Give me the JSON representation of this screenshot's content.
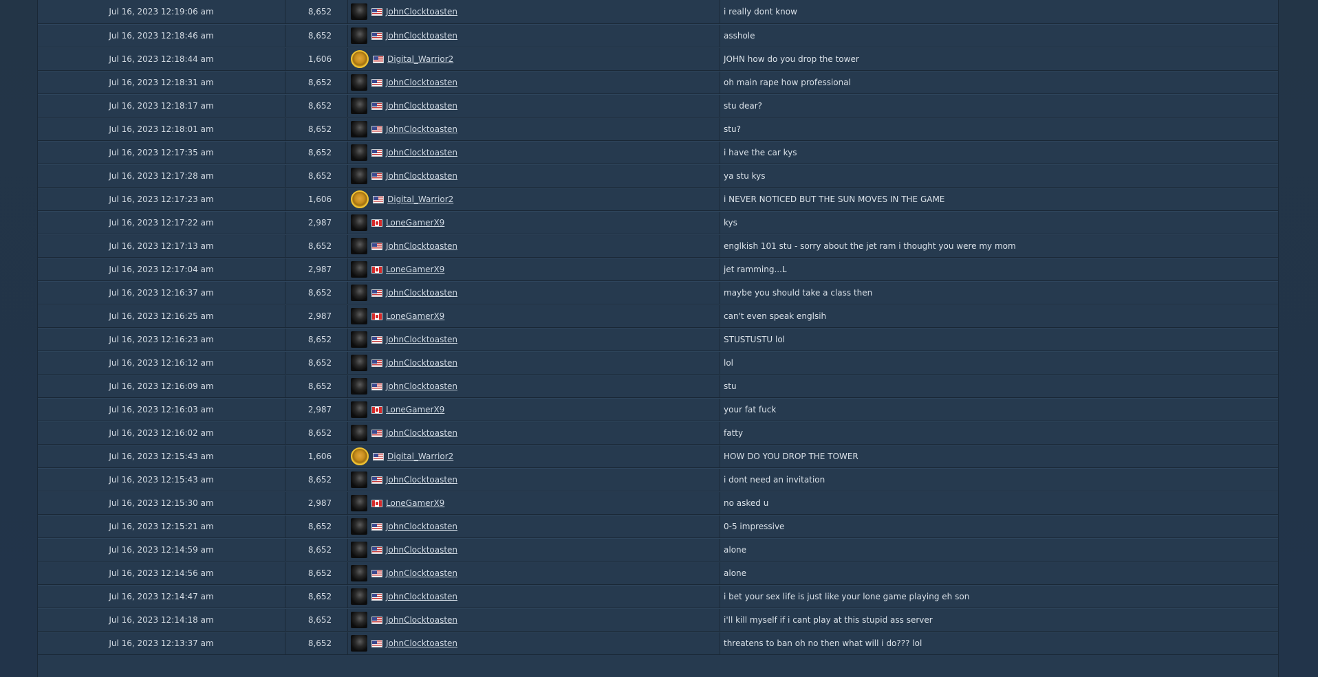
{
  "colors": {
    "background": "#233446",
    "row": "#263a4f",
    "border": "#1a2836",
    "text": "#d3dae2"
  },
  "chat_log": {
    "rows": [
      {
        "time": "Jul 16, 2023 12:19:06 am",
        "score": "8,652",
        "avatar": "dark",
        "flag": "us",
        "player": "JohnClocktoasten",
        "message": "i really dont know"
      },
      {
        "time": "Jul 16, 2023 12:18:46 am",
        "score": "8,652",
        "avatar": "dark",
        "flag": "us",
        "player": "JohnClocktoasten",
        "message": "asshole"
      },
      {
        "time": "Jul 16, 2023 12:18:44 am",
        "score": "1,606",
        "avatar": "gold",
        "flag": "us",
        "player": "Digital_Warrior2",
        "message": "JOHN how do you drop the tower"
      },
      {
        "time": "Jul 16, 2023 12:18:31 am",
        "score": "8,652",
        "avatar": "dark",
        "flag": "us",
        "player": "JohnClocktoasten",
        "message": "oh main rape how professional"
      },
      {
        "time": "Jul 16, 2023 12:18:17 am",
        "score": "8,652",
        "avatar": "dark",
        "flag": "us",
        "player": "JohnClocktoasten",
        "message": "stu dear?"
      },
      {
        "time": "Jul 16, 2023 12:18:01 am",
        "score": "8,652",
        "avatar": "dark",
        "flag": "us",
        "player": "JohnClocktoasten",
        "message": "stu?"
      },
      {
        "time": "Jul 16, 2023 12:17:35 am",
        "score": "8,652",
        "avatar": "dark",
        "flag": "us",
        "player": "JohnClocktoasten",
        "message": "i have the car kys"
      },
      {
        "time": "Jul 16, 2023 12:17:28 am",
        "score": "8,652",
        "avatar": "dark",
        "flag": "us",
        "player": "JohnClocktoasten",
        "message": "ya stu kys"
      },
      {
        "time": "Jul 16, 2023 12:17:23 am",
        "score": "1,606",
        "avatar": "gold",
        "flag": "us",
        "player": "Digital_Warrior2",
        "message": "i NEVER NOTICED BUT THE SUN MOVES IN THE GAME"
      },
      {
        "time": "Jul 16, 2023 12:17:22 am",
        "score": "2,987",
        "avatar": "dark",
        "flag": "ca",
        "player": "LoneGamerX9",
        "message": "kys"
      },
      {
        "time": "Jul 16, 2023 12:17:13 am",
        "score": "8,652",
        "avatar": "dark",
        "flag": "us",
        "player": "JohnClocktoasten",
        "message": "englkish 101 stu - sorry about the jet ram i thought you were my mom"
      },
      {
        "time": "Jul 16, 2023 12:17:04 am",
        "score": "2,987",
        "avatar": "dark",
        "flag": "ca",
        "player": "LoneGamerX9",
        "message": "jet ramming...L"
      },
      {
        "time": "Jul 16, 2023 12:16:37 am",
        "score": "8,652",
        "avatar": "dark",
        "flag": "us",
        "player": "JohnClocktoasten",
        "message": "maybe you should take a class then"
      },
      {
        "time": "Jul 16, 2023 12:16:25 am",
        "score": "2,987",
        "avatar": "dark",
        "flag": "ca",
        "player": "LoneGamerX9",
        "message": "can't even speak englsih"
      },
      {
        "time": "Jul 16, 2023 12:16:23 am",
        "score": "8,652",
        "avatar": "dark",
        "flag": "us",
        "player": "JohnClocktoasten",
        "message": "STUSTUSTU lol"
      },
      {
        "time": "Jul 16, 2023 12:16:12 am",
        "score": "8,652",
        "avatar": "dark",
        "flag": "us",
        "player": "JohnClocktoasten",
        "message": "lol"
      },
      {
        "time": "Jul 16, 2023 12:16:09 am",
        "score": "8,652",
        "avatar": "dark",
        "flag": "us",
        "player": "JohnClocktoasten",
        "message": "stu"
      },
      {
        "time": "Jul 16, 2023 12:16:03 am",
        "score": "2,987",
        "avatar": "dark",
        "flag": "ca",
        "player": "LoneGamerX9",
        "message": "your fat fuck"
      },
      {
        "time": "Jul 16, 2023 12:16:02 am",
        "score": "8,652",
        "avatar": "dark",
        "flag": "us",
        "player": "JohnClocktoasten",
        "message": "fatty"
      },
      {
        "time": "Jul 16, 2023 12:15:43 am",
        "score": "1,606",
        "avatar": "gold",
        "flag": "us",
        "player": "Digital_Warrior2",
        "message": "HOW DO YOU DROP THE TOWER"
      },
      {
        "time": "Jul 16, 2023 12:15:43 am",
        "score": "8,652",
        "avatar": "dark",
        "flag": "us",
        "player": "JohnClocktoasten",
        "message": "i dont need an invitation"
      },
      {
        "time": "Jul 16, 2023 12:15:30 am",
        "score": "2,987",
        "avatar": "dark",
        "flag": "ca",
        "player": "LoneGamerX9",
        "message": "no asked u"
      },
      {
        "time": "Jul 16, 2023 12:15:21 am",
        "score": "8,652",
        "avatar": "dark",
        "flag": "us",
        "player": "JohnClocktoasten",
        "message": "0-5 impressive"
      },
      {
        "time": "Jul 16, 2023 12:14:59 am",
        "score": "8,652",
        "avatar": "dark",
        "flag": "us",
        "player": "JohnClocktoasten",
        "message": "alone"
      },
      {
        "time": "Jul 16, 2023 12:14:56 am",
        "score": "8,652",
        "avatar": "dark",
        "flag": "us",
        "player": "JohnClocktoasten",
        "message": "alone"
      },
      {
        "time": "Jul 16, 2023 12:14:47 am",
        "score": "8,652",
        "avatar": "dark",
        "flag": "us",
        "player": "JohnClocktoasten",
        "message": "i bet your sex life is just like your lone game playing eh son"
      },
      {
        "time": "Jul 16, 2023 12:14:18 am",
        "score": "8,652",
        "avatar": "dark",
        "flag": "us",
        "player": "JohnClocktoasten",
        "message": "i'll kill myself if i cant play at this stupid ass server"
      },
      {
        "time": "Jul 16, 2023 12:13:37 am",
        "score": "8,652",
        "avatar": "dark",
        "flag": "us",
        "player": "JohnClocktoasten",
        "message": "threatens to ban oh no then what will i do??? lol"
      }
    ]
  }
}
